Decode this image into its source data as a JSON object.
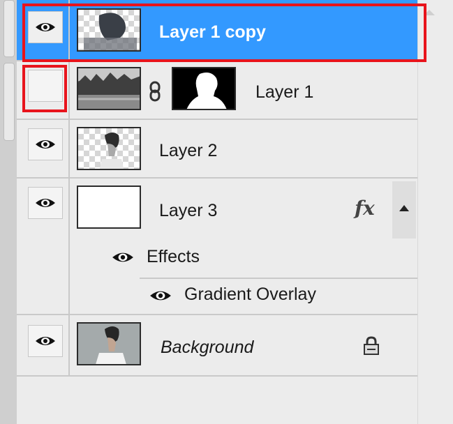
{
  "panel": {
    "layers": [
      {
        "name": "Layer 1 copy",
        "visible": true,
        "selected": true,
        "thumbnail": "checker-dark-hair"
      },
      {
        "name": "Layer 1",
        "visible": false,
        "selected": false,
        "thumbnail": "forest-photo",
        "mask": "head-silhouette-mask",
        "link_icon": "chain-link-icon"
      },
      {
        "name": "Layer 2",
        "visible": true,
        "selected": false,
        "thumbnail": "checker-man-portrait"
      },
      {
        "name": "Layer 3",
        "visible": true,
        "selected": false,
        "thumbnail": "white",
        "fx_label": "fx",
        "fx_toggle_icon": "triangle-up-icon",
        "effects_label": "Effects",
        "effects": [
          {
            "name": "Gradient Overlay",
            "visible": true
          }
        ]
      },
      {
        "name": "Background",
        "visible": true,
        "selected": false,
        "thumbnail": "man-portrait-photo",
        "locked": true,
        "lock_icon": "lock-icon"
      }
    ]
  },
  "colors": {
    "selection": "#3399ff",
    "highlight_annotation": "#e8141c",
    "panel_bg": "#ececec"
  }
}
